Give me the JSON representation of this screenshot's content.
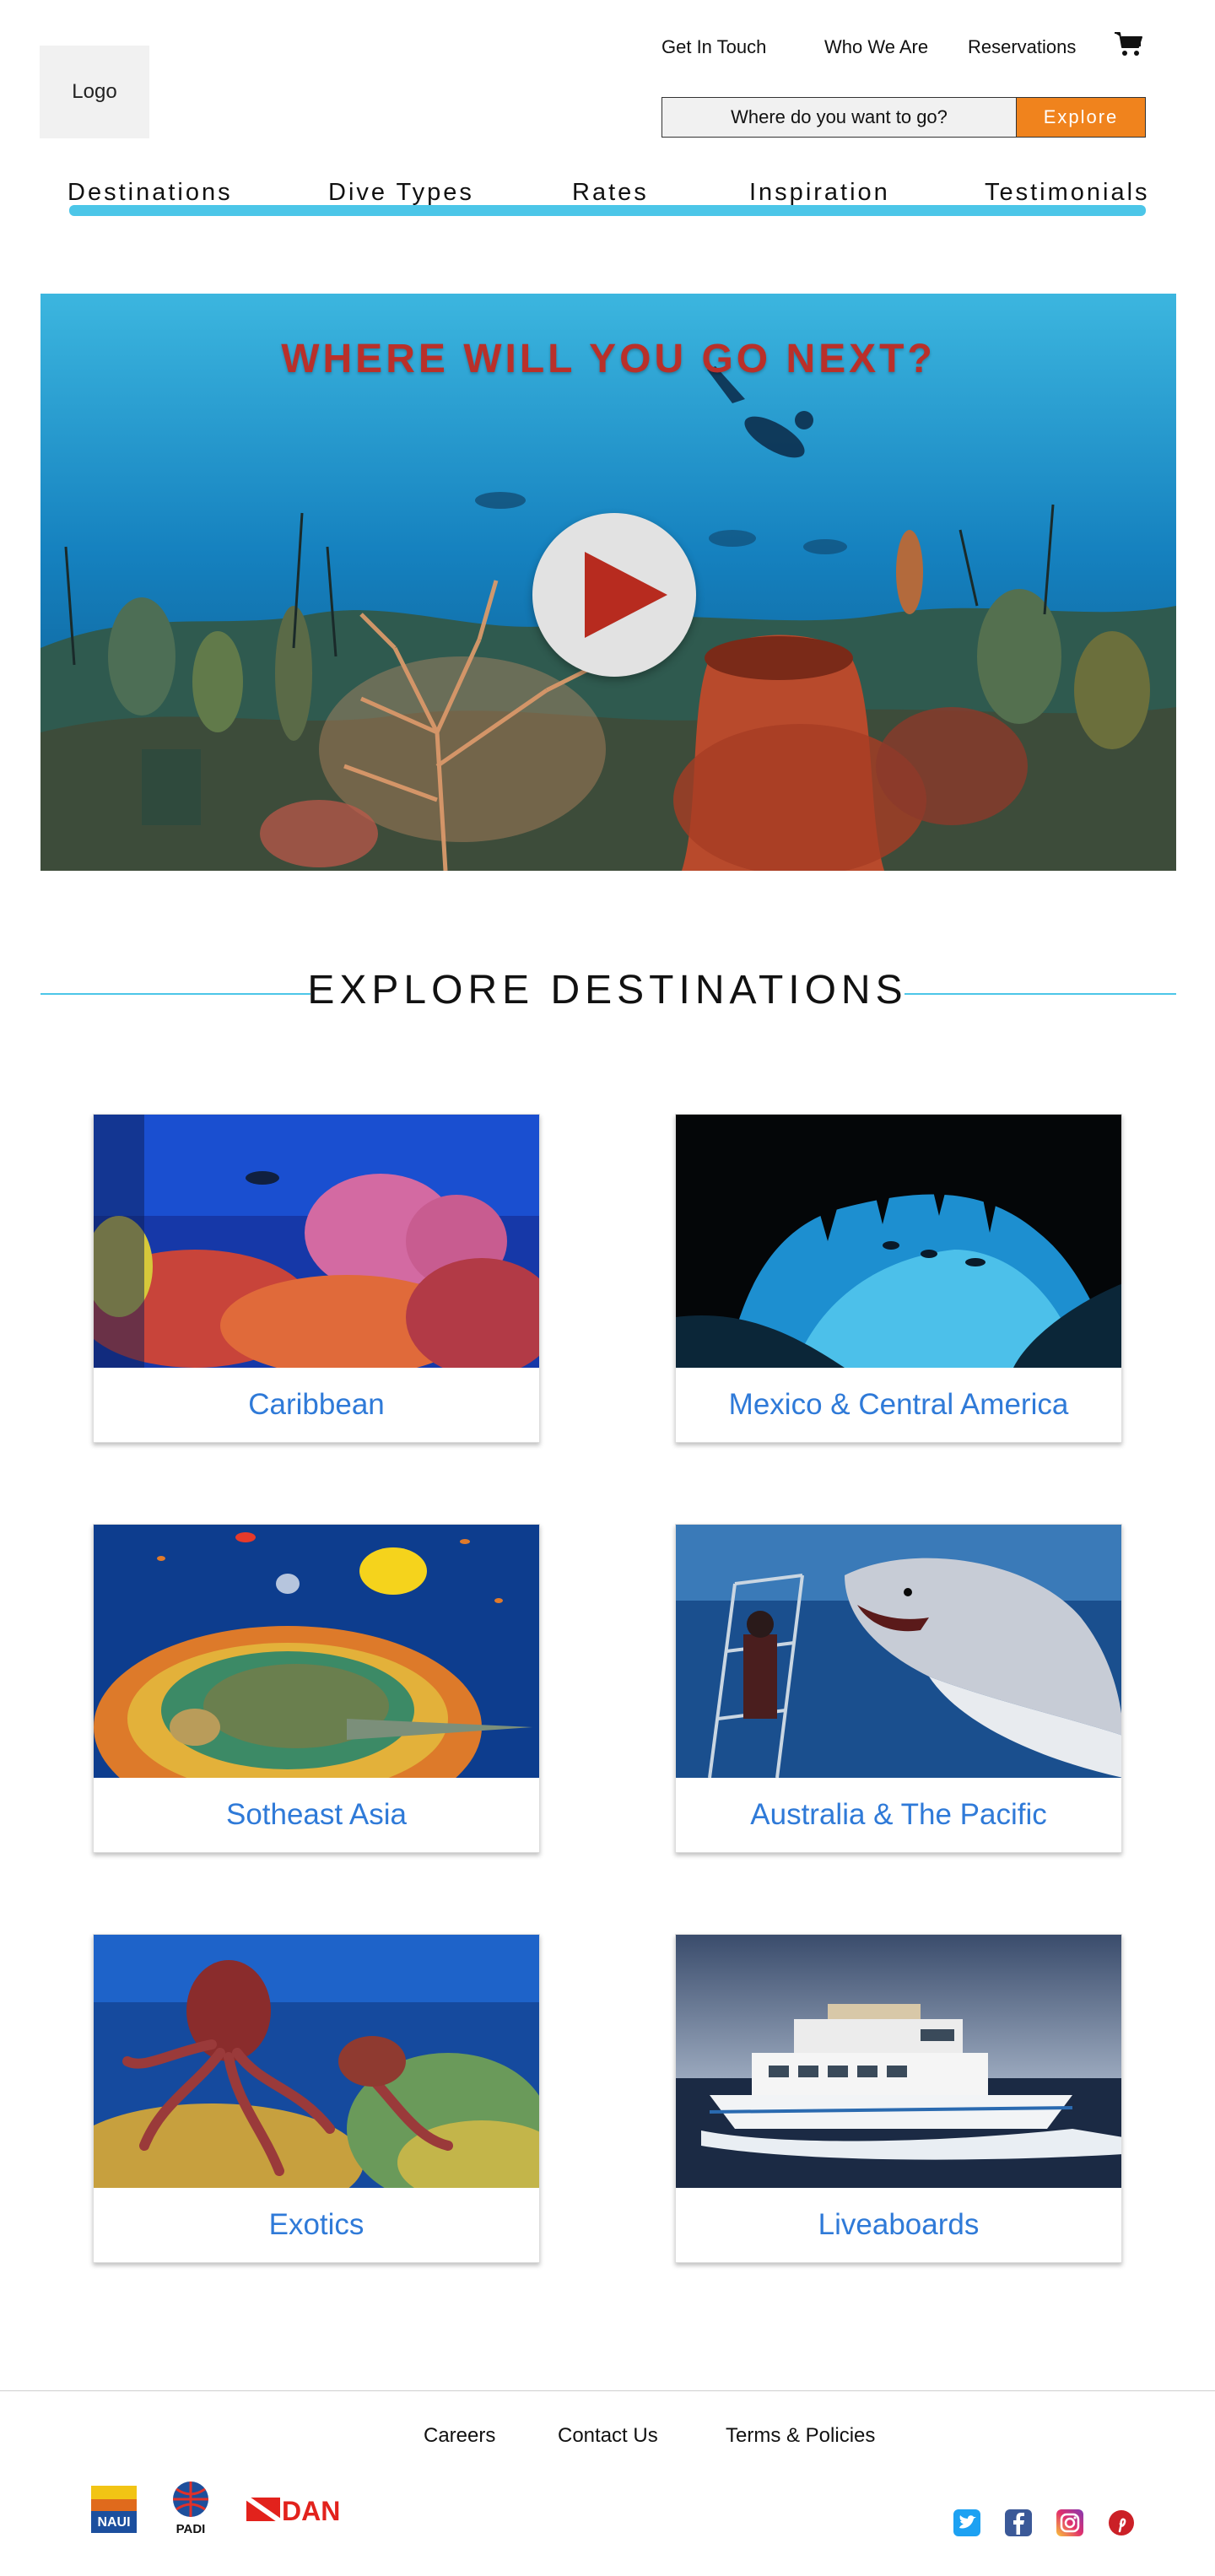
{
  "header": {
    "logo_text": "Logo",
    "top_links": [
      "Get In Touch",
      "Who We Are",
      "Reservations"
    ],
    "cart_icon": "shopping-cart-icon",
    "search": {
      "placeholder": "Where do you want to go?",
      "button_label": "Explore"
    }
  },
  "nav": {
    "items": [
      "Destinations",
      "Dive Types",
      "Rates",
      "Inspiration",
      "Testimonials"
    ],
    "accent_color": "#4cc6e8"
  },
  "hero": {
    "title": "WHERE WILL YOU GO NEXT?",
    "play_icon": "play-icon",
    "title_color": "#b9302a"
  },
  "destinations": {
    "heading": "EXPLORE DESTINATIONS",
    "cards": [
      {
        "label": "Caribbean"
      },
      {
        "label": "Mexico & Central America"
      },
      {
        "label": "Sotheast Asia"
      },
      {
        "label": "Australia & The Pacific"
      },
      {
        "label": "Exotics"
      },
      {
        "label": "Liveaboards"
      }
    ],
    "label_color": "#2f7ad8"
  },
  "footer": {
    "links": [
      "Careers",
      "Contact Us",
      "Terms & Policies"
    ],
    "certifications": [
      "NAUI",
      "PADI",
      "DAN"
    ],
    "social_icons": [
      "twitter-icon",
      "facebook-icon",
      "instagram-icon",
      "pinterest-icon"
    ]
  }
}
